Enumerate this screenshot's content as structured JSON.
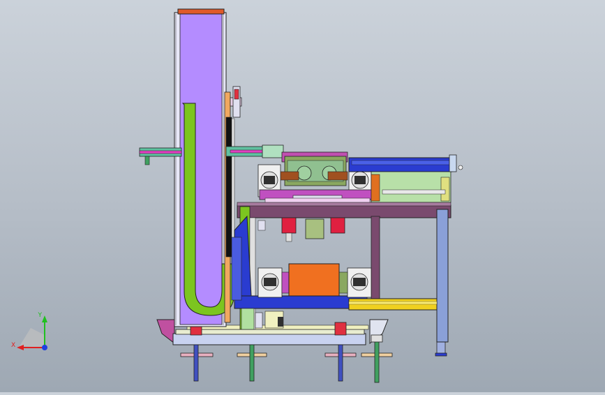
{
  "viewport": {
    "background_top": "#cbd2da",
    "background_bottom": "#9ea8b3",
    "triad": {
      "x_label": "X",
      "y_label": "Y",
      "x_color": "#e02020",
      "y_color": "#20c020",
      "origin_color": "#2040e0"
    }
  },
  "model": {
    "colors": {
      "column_body": "#b48cff",
      "column_cap": "#e05a2a",
      "hook_tube": "#7cc520",
      "table_top": "#7a4a6e",
      "frame_leg": "#8aa0d8",
      "blue_frame": "#2a3cd0",
      "yellow_rail": "#f0d020",
      "orange_box": "#f07020",
      "conveyor_green": "#b8e0a8",
      "base_plate": "#c8d2f0",
      "red_motor": "#e02040"
    }
  }
}
